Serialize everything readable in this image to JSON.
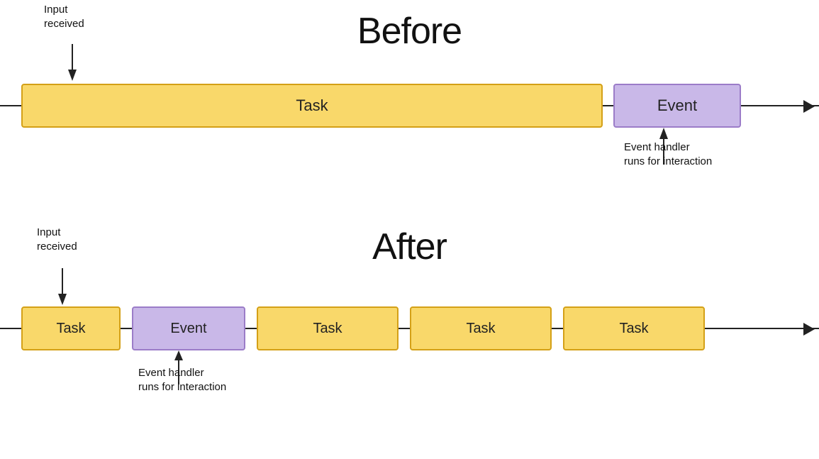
{
  "before": {
    "title": "Before",
    "input_label": "Input\nreceived",
    "task_label": "Task",
    "event_label": "Event",
    "event_handler_label": "Event handler\nruns for interaction"
  },
  "after": {
    "title": "After",
    "input_label": "Input\nreceived",
    "task_label_1": "Task",
    "event_label": "Event",
    "task_label_2": "Task",
    "task_label_3": "Task",
    "task_label_4": "Task",
    "event_handler_label": "Event handler\nruns for interaction"
  },
  "colors": {
    "task_bg": "#f9d86a",
    "task_border": "#d4a017",
    "event_bg": "#c9b8e8",
    "event_border": "#9b7cc8"
  }
}
